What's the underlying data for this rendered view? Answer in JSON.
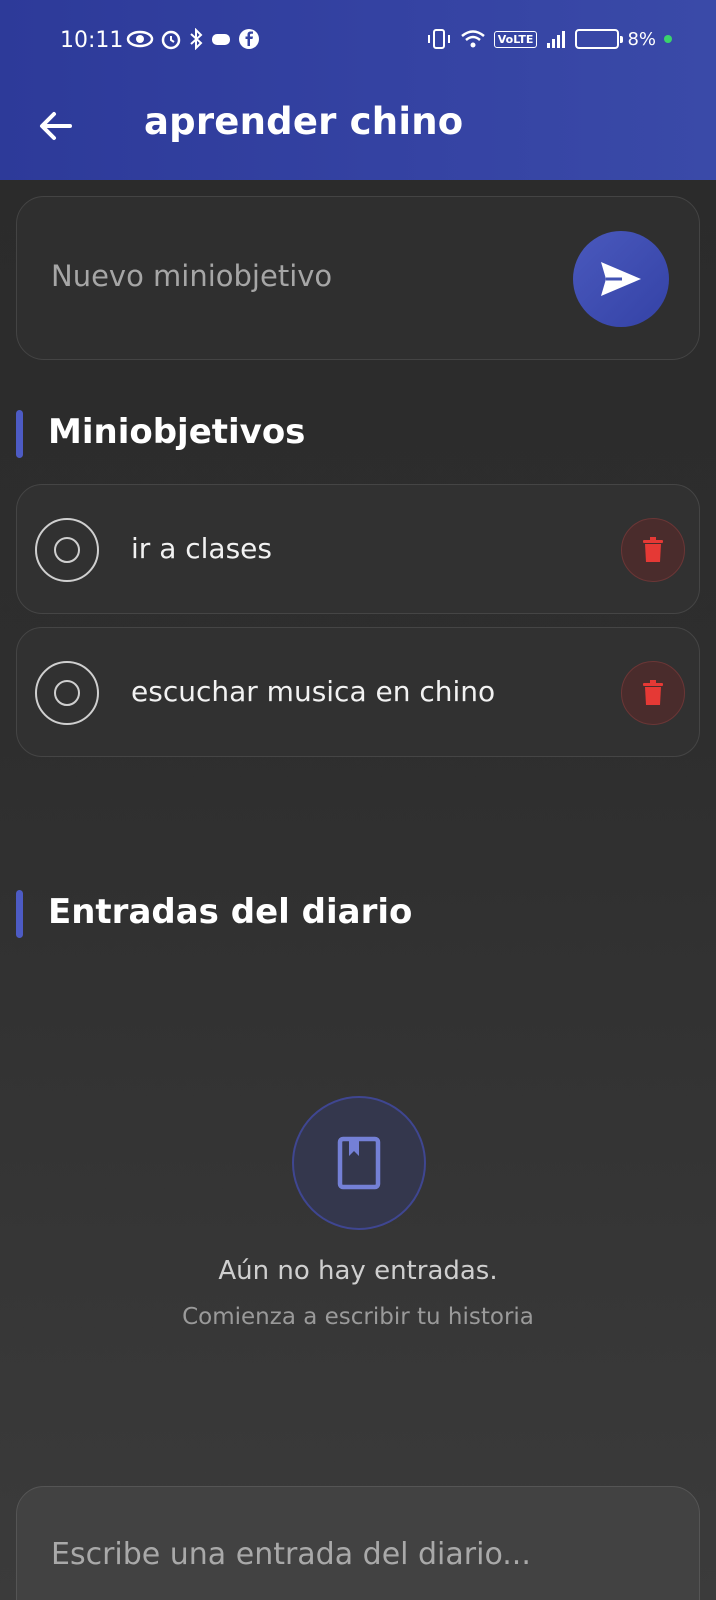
{
  "status_bar": {
    "time": "10:11",
    "volte": "VoLTE",
    "battery": "8%"
  },
  "app_bar": {
    "title": "aprender chino"
  },
  "new_goal": {
    "placeholder": "Nuevo miniobjetivo"
  },
  "miniobjetivos": {
    "title": "Miniobjetivos",
    "items": [
      {
        "label": "ir a clases",
        "completed": false
      },
      {
        "label": "escuchar musica en chino",
        "completed": false
      }
    ]
  },
  "diario": {
    "title": "Entradas del diario",
    "empty_title": "Aún no hay entradas.",
    "empty_subtitle": "Comienza a escribir tu historia",
    "input_placeholder": "Escribe una entrada del diario..."
  },
  "colors": {
    "app_bar": "#3543a3",
    "accent": "#4d5bc4",
    "delete": "#e53935",
    "status_dot": "#3ad36b"
  },
  "icons": [
    "back-arrow-icon",
    "send-icon",
    "radio-unchecked-icon",
    "trash-icon",
    "bookmark-book-icon"
  ]
}
